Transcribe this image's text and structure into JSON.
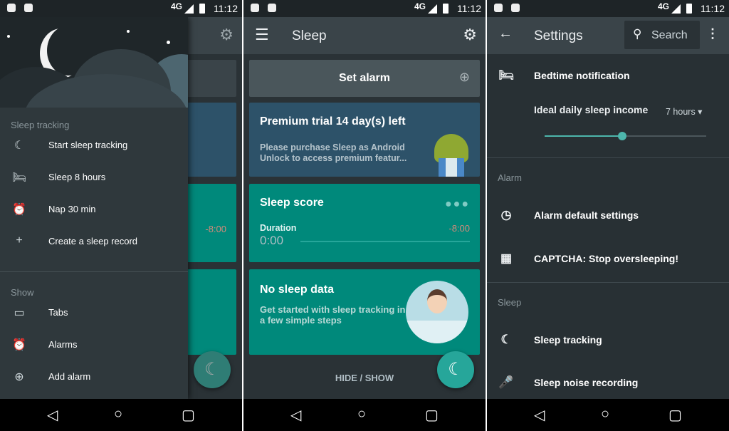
{
  "status": {
    "network": "4G",
    "time": "11:12"
  },
  "drawer": {
    "sections": [
      {
        "title": "Sleep tracking",
        "items": [
          {
            "icon": "moon-icon",
            "glyph": "☾",
            "label": "Start sleep tracking"
          },
          {
            "icon": "bed-icon",
            "glyph": "🛏",
            "label": "Sleep 8 hours"
          },
          {
            "icon": "alarm-z-icon",
            "glyph": "⏰",
            "label": "Nap 30 min"
          },
          {
            "icon": "plus-icon",
            "glyph": "+",
            "label": "Create a sleep record"
          }
        ]
      },
      {
        "title": "Show",
        "items": [
          {
            "icon": "tabs-icon",
            "glyph": "▭",
            "label": "Tabs"
          },
          {
            "icon": "alarm-icon",
            "glyph": "⏰",
            "label": "Alarms"
          },
          {
            "icon": "add-alarm-icon",
            "glyph": "⊕",
            "label": "Add alarm"
          }
        ]
      }
    ],
    "background_time": "-8:00"
  },
  "main": {
    "title": "Sleep",
    "set_alarm": "Set alarm",
    "premium": {
      "title": "Premium trial 14 day(s) left",
      "text1": "Please purchase Sleep as Android",
      "text2": "Unlock to access premium featur..."
    },
    "score": {
      "title": "Sleep score",
      "duration_label": "Duration",
      "duration": "0:00",
      "remaining": "-8:00"
    },
    "nodata": {
      "title": "No sleep data",
      "text1": "Get started with sleep tracking in",
      "text2": "a few simple steps"
    },
    "hide_show": "HIDE / SHOW"
  },
  "settings": {
    "title": "Settings",
    "search": "Search",
    "bedtime": "Bedtime notification",
    "ideal_label": "Ideal daily sleep income",
    "ideal_value": "7 hours",
    "slider_percent": 48,
    "sections": [
      {
        "title": "Alarm",
        "items": [
          {
            "icon": "clock-icon",
            "glyph": "◷",
            "label": "Alarm default settings"
          },
          {
            "icon": "qr-code-icon",
            "glyph": "▦",
            "label": "CAPTCHA: Stop oversleeping!"
          }
        ]
      },
      {
        "title": "Sleep",
        "items": [
          {
            "icon": "moon-icon",
            "glyph": "☾",
            "label": "Sleep tracking"
          },
          {
            "icon": "microphone-icon",
            "glyph": "🎤",
            "label": "Sleep noise recording"
          }
        ]
      }
    ]
  },
  "colors": {
    "teal": "#009688",
    "premium": "#2d5269",
    "appbar": "#3a4449",
    "background": "#2a3236"
  }
}
